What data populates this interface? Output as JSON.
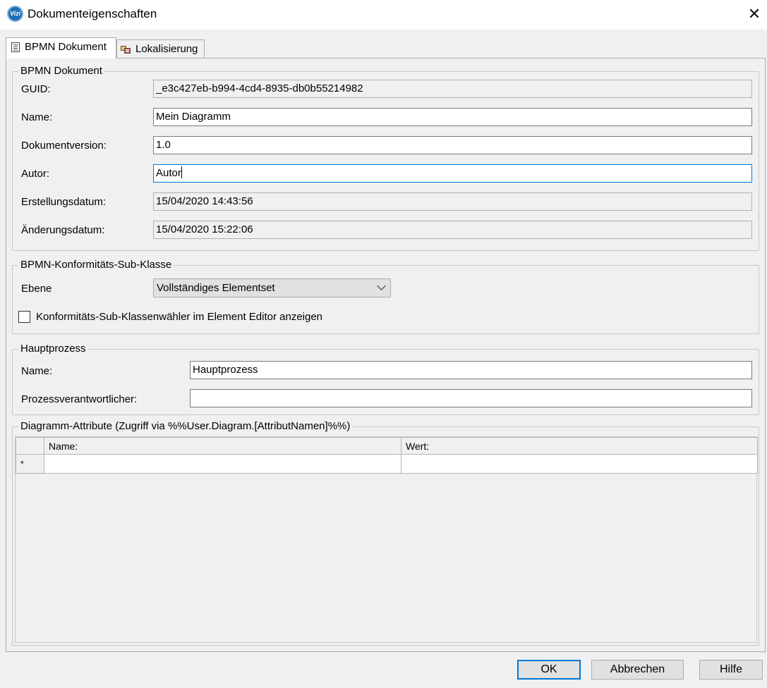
{
  "window": {
    "title": "Dokumenteigenschaften",
    "app_icon_text": "Vizi"
  },
  "tabs": [
    {
      "label": "BPMN Dokument",
      "icon": "document-icon",
      "active": true
    },
    {
      "label": "Lokalisierung",
      "icon": "localization-icon",
      "active": false
    }
  ],
  "bpmn_document": {
    "group_title": "BPMN Dokument",
    "guid_label": "GUID:",
    "guid_value": "_e3c427eb-b994-4cd4-8935-db0b55214982",
    "name_label": "Name:",
    "name_value": "Mein Diagramm",
    "version_label": "Dokumentversion:",
    "version_value": "1.0",
    "author_label": "Autor:",
    "author_value": "Autor",
    "created_label": "Erstellungsdatum:",
    "created_value": "15/04/2020 14:43:56",
    "modified_label": "Änderungsdatum:",
    "modified_value": "15/04/2020 15:22:06"
  },
  "conformance": {
    "group_title": "BPMN-Konformitäts-Sub-Klasse",
    "level_label": "Ebene",
    "level_value": "Vollständiges Elementset",
    "checkbox_label": "Konformitäts-Sub-Klassenwähler im Element Editor anzeigen",
    "checkbox_checked": false
  },
  "main_process": {
    "group_title": "Hauptprozess",
    "name_label": "Name:",
    "name_value": "Hauptprozess",
    "owner_label": "Prozessverantwortlicher:",
    "owner_value": ""
  },
  "diagram_attributes": {
    "group_title": "Diagramm-Attribute (Zugriff via %%User.Diagram.[AttributNamen]%%)",
    "columns": [
      "Name:",
      "Wert:"
    ],
    "new_row_marker": "*",
    "rows": []
  },
  "buttons": {
    "ok": "OK",
    "cancel": "Abbrechen",
    "help": "Hilfe"
  },
  "colors": {
    "focus_border": "#0078d7",
    "app_icon": "#1e6fb6"
  }
}
